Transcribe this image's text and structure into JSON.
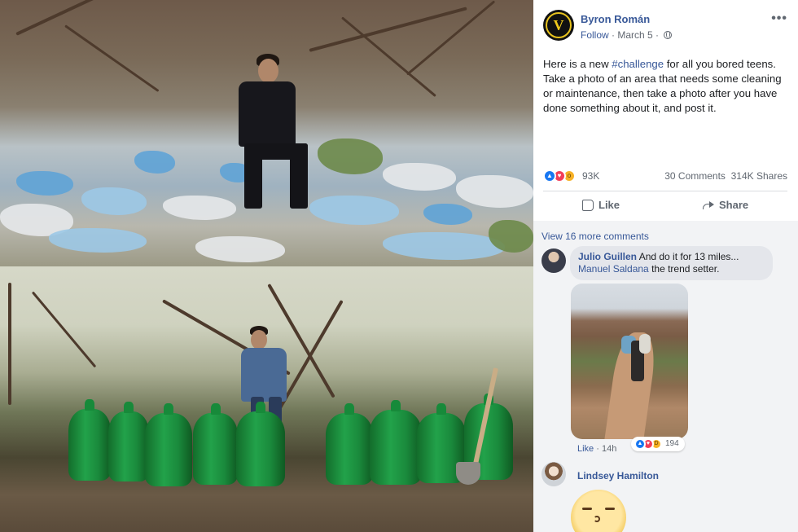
{
  "post": {
    "author": "Byron Román",
    "follow_label": "Follow",
    "meta_separator": " · ",
    "date": "March 5",
    "date_suffix": " ·",
    "more_label": "•••",
    "avatar_letter": "V",
    "text_before_hashtag": "Here is a new ",
    "hashtag": "#challenge",
    "text_after_hashtag": " for all you bored teens. Take a photo of an area that needs some cleaning or maintenance, then take a photo after you have done something about it, and post it.",
    "reaction_count": "93K",
    "comments_count": "30 Comments",
    "shares_count": "314K Shares",
    "like_label": "Like",
    "share_label": "Share",
    "icons": {
      "reactions": [
        "like-icon",
        "love-icon",
        "wow-icon"
      ],
      "like_action": "thumbs-up-icon",
      "share_action": "share-arrow-icon",
      "privacy": "globe-icon"
    },
    "colors": {
      "link": "#385898",
      "like_blue": "#1877f2",
      "love_red": "#f33e58",
      "wow_yellow": "#f7b125"
    }
  },
  "comments": {
    "view_more": "View 16 more comments",
    "first": {
      "name": "Julio Guillen",
      "text": "And do it for 13 miles...",
      "mention": "Manuel Saldana",
      "mention_rest": "the trend setter.",
      "like_label": "Like",
      "separator": " · ",
      "time": "14h",
      "reaction_count": "194"
    },
    "second": {
      "name": "Lindsey Hamilton"
    }
  }
}
